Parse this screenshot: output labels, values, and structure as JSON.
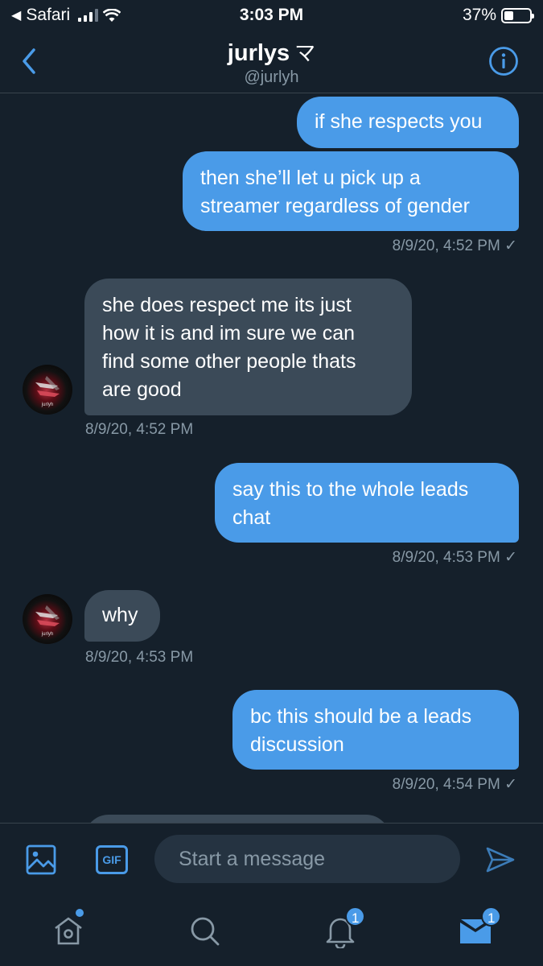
{
  "status_bar": {
    "back_app": "Safari",
    "time": "3:03 PM",
    "battery_percent": "37%",
    "battery_level": 0.37
  },
  "header": {
    "name": "jurlys",
    "name_mark": "マ",
    "handle": "@jurlyh"
  },
  "messages": [
    {
      "dir": "out",
      "text": "if she respects you"
    },
    {
      "dir": "out",
      "text": "then she’ll let u pick up a streamer regardless of gender",
      "line1": "then she’ll let u pick up a",
      "line2": "streamer regardless of gender",
      "time": "8/9/20, 4:52 PM ✓"
    },
    {
      "dir": "in",
      "line1": "she does respect me its just",
      "line2": "how it is and im sure we can",
      "line3": "find some other people thats",
      "line4": "are good",
      "time": "8/9/20, 4:52 PM"
    },
    {
      "dir": "out",
      "line1": "say this to the whole leads",
      "line2": "chat",
      "time": "8/9/20, 4:53 PM ✓"
    },
    {
      "dir": "in",
      "text": "why",
      "time": "8/9/20, 4:53 PM"
    },
    {
      "dir": "out",
      "line1": "bc this should be a leads",
      "line2": "discussion",
      "time": "8/9/20, 4:54 PM ✓"
    }
  ],
  "avatar_label": "jurlyh",
  "composer": {
    "placeholder": "Start a message",
    "gif_label": "GIF"
  },
  "tabbar": {
    "notifications_badge": "1",
    "messages_badge": "1"
  },
  "colors": {
    "background": "#15202b",
    "outgoing_bubble": "#4a9be8",
    "incoming_bubble": "#3b4a58",
    "accent": "#4a9be8",
    "secondary_text": "#8899a6"
  },
  "icons": [
    "back-chevron-icon",
    "info-icon",
    "image-icon",
    "gif-icon",
    "send-icon",
    "home-icon",
    "search-icon",
    "bell-icon",
    "mail-icon"
  ]
}
